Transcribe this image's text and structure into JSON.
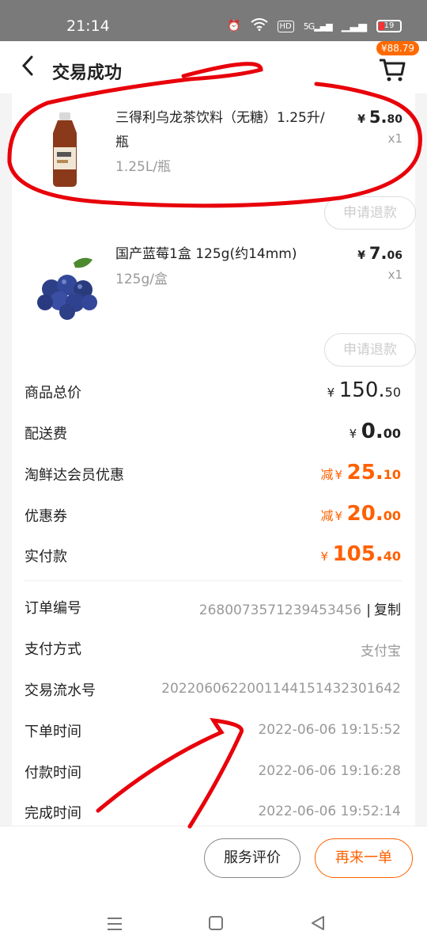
{
  "status": {
    "time": "21:14",
    "network": "5G",
    "battery": "19"
  },
  "header": {
    "title": "交易成功",
    "cart_badge": "¥88.79"
  },
  "products": [
    {
      "name": "三得利乌龙茶饮料（无糖）1.25升/瓶",
      "spec": "1.25L/瓶",
      "price_int": "5.",
      "price_dec": "80",
      "qty": "x1",
      "refund_label": "申请退款"
    },
    {
      "name": "国产蓝莓1盒 125g(约14mm)",
      "spec": "125g/盒",
      "price_int": "7.",
      "price_dec": "06",
      "qty": "x1",
      "refund_label": "申请退款"
    }
  ],
  "currency": "¥",
  "summary": {
    "goods_total": {
      "label": "商品总价",
      "int": "150.",
      "dec": "50"
    },
    "delivery": {
      "label": "配送费",
      "int": "0.",
      "dec": "00"
    },
    "member_discount": {
      "label": "淘鲜达会员优惠",
      "prefix": "减",
      "int": "25.",
      "dec": "10"
    },
    "coupon": {
      "label": "优惠券",
      "prefix": "减",
      "int": "20.",
      "dec": "00"
    },
    "paid": {
      "label": "实付款",
      "int": "105.",
      "dec": "40"
    }
  },
  "info": {
    "order_no": {
      "label": "订单编号",
      "value": "2680073571239453456",
      "copy": "复制"
    },
    "pay_method": {
      "label": "支付方式",
      "value": "支付宝"
    },
    "txn_no": {
      "label": "交易流水号",
      "value": "2022060622001144151432301642"
    },
    "order_time": {
      "label": "下单时间",
      "value": "2022-06-06 19:15:52"
    },
    "pay_time": {
      "label": "付款时间",
      "value": "2022-06-06 19:16:28"
    },
    "done_time": {
      "label": "完成时间",
      "value": "2022-06-06 19:52:14"
    }
  },
  "actions": {
    "review": "服务评价",
    "reorder": "再来一单"
  },
  "colors": {
    "accent": "#ff6000",
    "annotation": "#e8000a"
  }
}
